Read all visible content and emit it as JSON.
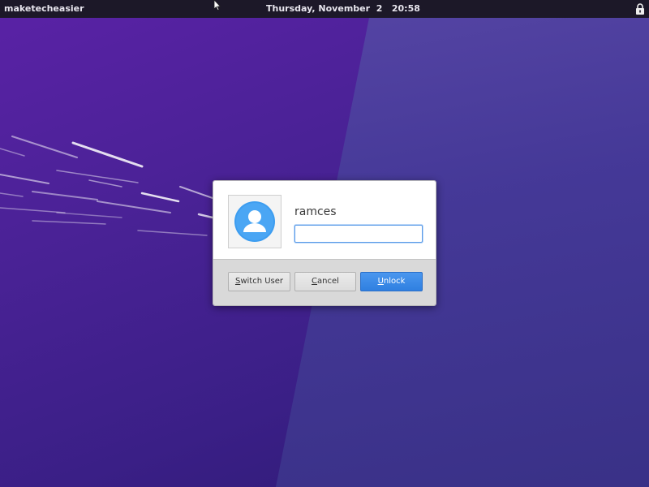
{
  "top_panel": {
    "host_name": "maketecheasier",
    "date": "Thursday, November  2",
    "time": "20:58",
    "lock_icon": "lock-icon"
  },
  "dialog": {
    "avatar_icon": "user-avatar-icon",
    "user_name": "ramces",
    "password_value": "",
    "buttons": {
      "switch_user": {
        "accel": "S",
        "rest": "witch User"
      },
      "cancel": {
        "accel": "C",
        "rest": "ancel"
      },
      "unlock": {
        "accel": "U",
        "rest": "nlock"
      }
    }
  },
  "colors": {
    "wallpaper_dark": "#4a2296",
    "wallpaper_light": "#453a98",
    "panel_bg": "#1c1828",
    "accent_blue": "#3584e4",
    "avatar_blue": "#3d9df0"
  }
}
